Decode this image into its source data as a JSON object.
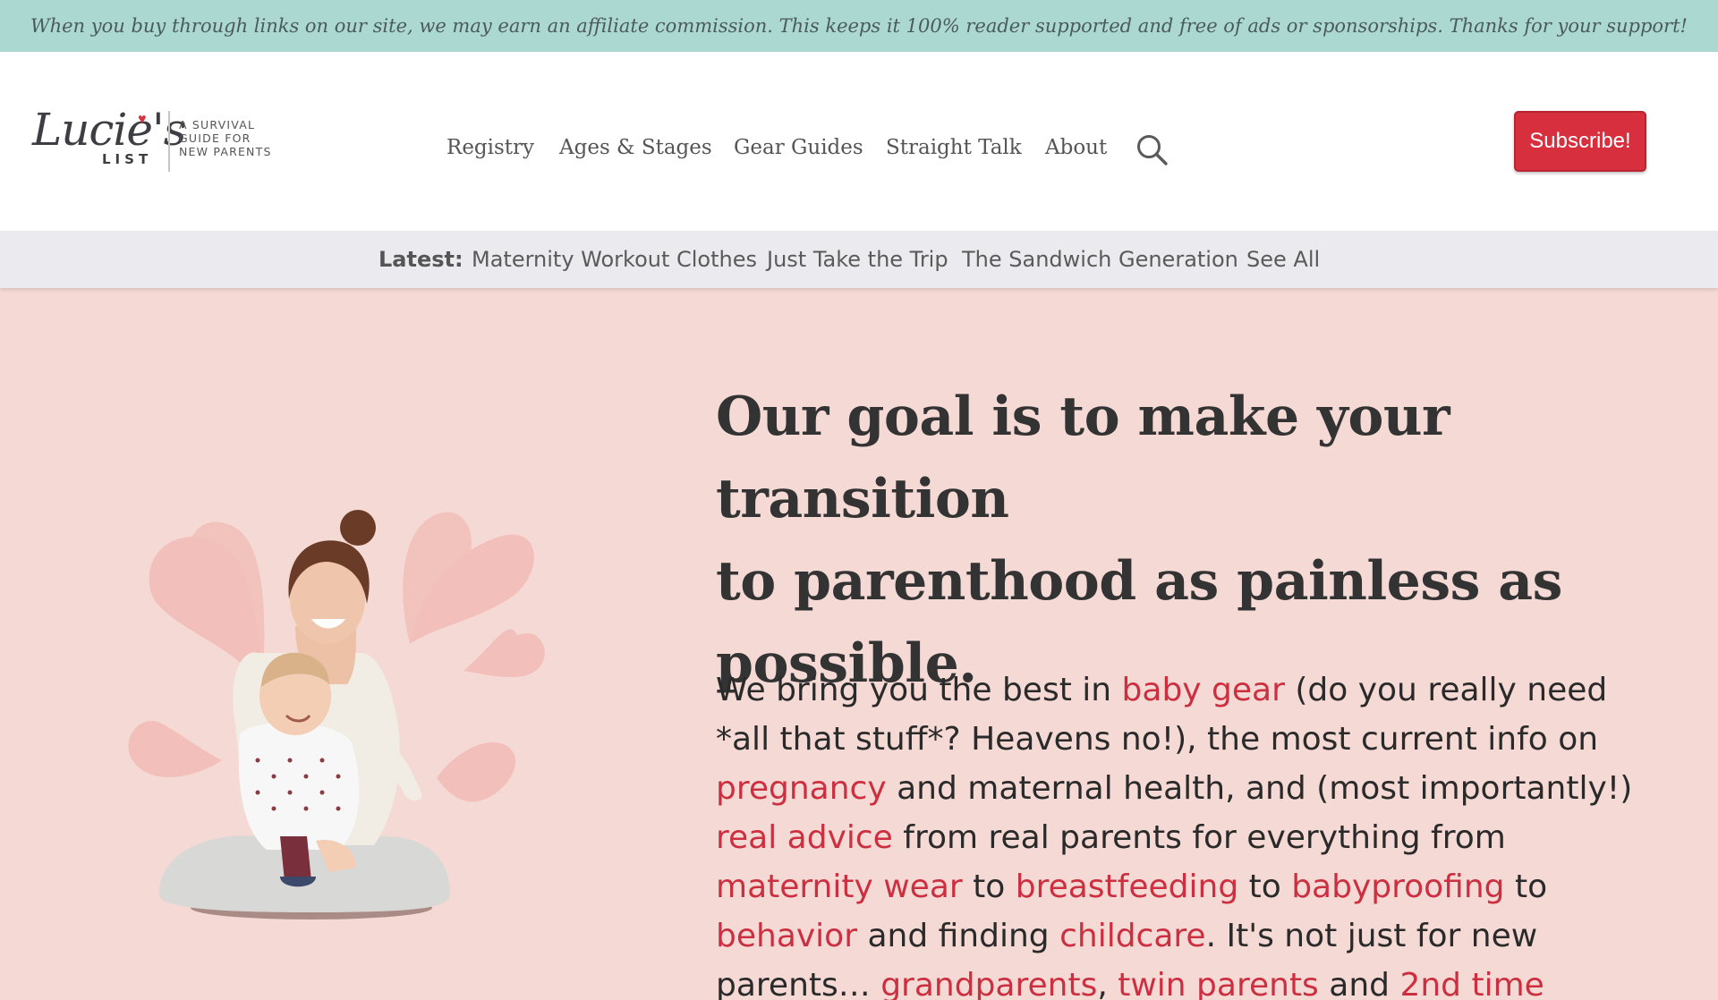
{
  "affiliate_notice": "When you buy through links on our site, we may earn an affiliate commission. This keeps it 100% reader supported and free of ads or sponsorships. Thanks for your support!",
  "logo": {
    "script_text": "Lucie's",
    "list_text": "LIST",
    "tagline_line1": "A SURVIVAL",
    "tagline_line2": "GUIDE FOR",
    "tagline_line3": "NEW PARENTS"
  },
  "nav": {
    "items": [
      "Registry",
      "Ages & Stages",
      "Gear Guides",
      "Straight Talk",
      "About"
    ],
    "search_icon": "search-icon"
  },
  "subscribe_label": "Subscribe!",
  "latest": {
    "label": "Latest:",
    "items": [
      "Maternity Workout Clothes",
      "Just Take the Trip",
      "The Sandwich Generation",
      "See All"
    ]
  },
  "hero": {
    "title_line1": "Our goal is to make your transition",
    "title_line2": "to parenthood as painless as",
    "title_line3": "possible.",
    "body": {
      "l1_a": "We bring you the best in ",
      "l1_link": "baby gear",
      "l1_b": " (do you really need",
      "l2": "*all that stuff*? Heavens no!), the most current info on",
      "l3_link": "pregnancy",
      "l3_b": " and maternal health, and (most importantly!)",
      "l4_link": "real advice",
      "l4_b": " from real parents for everything from",
      "l5_link1": "maternity wear",
      "l5_b": " to ",
      "l5_link2": "breastfeeding",
      "l5_c": " to ",
      "l5_link3": "babyproofing",
      "l5_d": " to",
      "l6_link1": "behavior",
      "l6_b": " and finding ",
      "l6_link2": "childcare",
      "l6_c": ". It's not just for new",
      "l7_a": "parents… ",
      "l7_link1": "grandparents",
      "l7_b": ", ",
      "l7_link2": "twin parents",
      "l7_c": " and ",
      "l7_link3": "2nd time"
    }
  },
  "colors": {
    "accent_red": "#d82f3f",
    "link_red": "#cc3040",
    "affiliate_bg": "#acd8d2",
    "page_bg": "#f5d9d5",
    "heart_pink": "#f2bfba"
  }
}
